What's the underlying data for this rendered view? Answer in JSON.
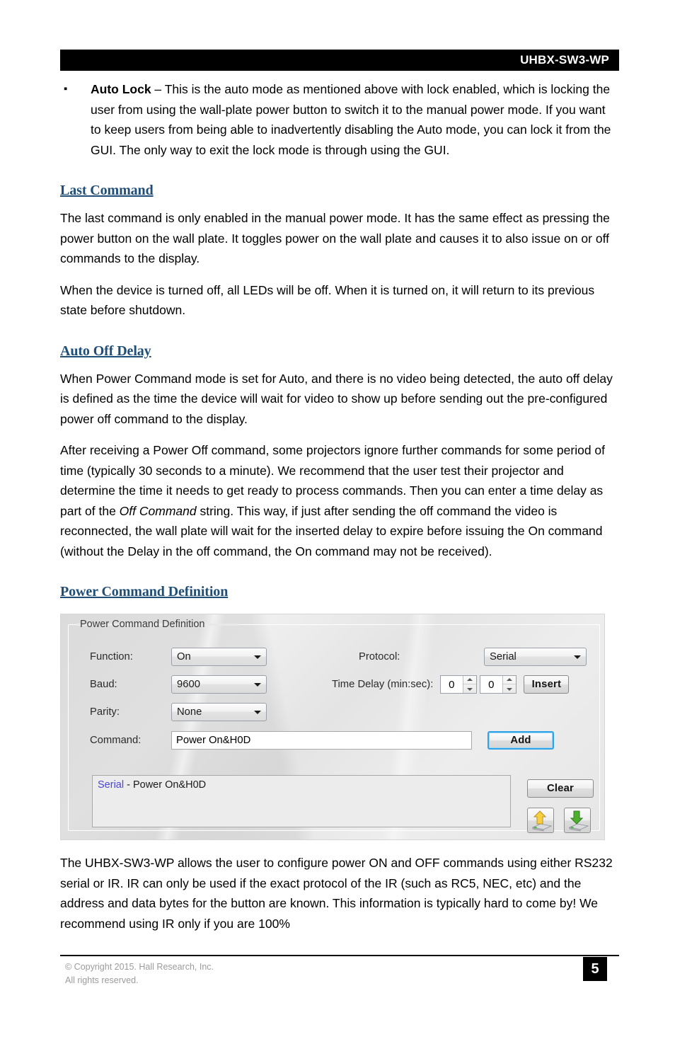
{
  "header": {
    "title": "UHBX-SW3-WP"
  },
  "colors": {
    "heading": "#1F4E79",
    "header_bar": "#000000",
    "focus_ring": "#2FA3E8",
    "list_protocol": "#4A46D6",
    "footer_text": "#9B9B9B"
  },
  "bullets": [
    {
      "glyph": "▪",
      "lead": "Auto Lock",
      "text": " – This is the auto mode as mentioned above with lock enabled, which is locking the user from using the wall-plate power button to switch it to the manual power mode. If you want to keep users from being able to inadvertently disabling the Auto mode, you can lock it from the GUI. The only way to exit the lock mode is through using the GUI."
    }
  ],
  "sections": [
    {
      "heading": "Last Command",
      "paragraphs": [
        "The last command is only enabled in the manual power mode. It has the same effect as pressing the power button on the wall plate. It toggles power on the wall plate and causes it to also issue on or off commands to the display.",
        "When the device is turned off, all LEDs will be off. When it is turned on, it will return to its previous state before shutdown."
      ]
    },
    {
      "heading": "Auto Off Delay",
      "paragraphs": [
        "When Power Command mode is set for Auto, and there is no video being detected, the auto off delay is defined as the time the device will wait for video to show up before sending out the pre-configured power off command to the display."
      ],
      "paragraph2_parts": {
        "a": "After receiving a Power Off command, some projectors ignore further commands for some period of time (typically 30 seconds to a minute). We recommend that the user test their projector and determine the time it needs to get ready to process commands. Then you can enter a time delay as part of the ",
        "italic": "Off Command",
        "b": " string. This way, if just after sending the off command the video is reconnected, the wall plate will wait for the inserted delay to expire before issuing the On command (without the Delay in the off command, the On command may not be received)."
      }
    },
    {
      "heading": "Power Command Definition"
    }
  ],
  "gui": {
    "groupbox_title": "Power Command Definition",
    "fields": {
      "function_label": "Function:",
      "function_value": "On",
      "baud_label": "Baud:",
      "baud_value": "9600",
      "parity_label": "Parity:",
      "parity_value": "None",
      "command_label": "Command:",
      "command_value": "Power On&H0D",
      "protocol_label": "Protocol:",
      "protocol_value": "Serial",
      "time_delay_label": "Time Delay (min:sec):",
      "time_delay_min": "0",
      "time_delay_sec": "0"
    },
    "buttons": {
      "insert": "Insert",
      "add": "Add",
      "clear": "Clear"
    },
    "icon_buttons": [
      {
        "name": "upload-to-device-icon"
      },
      {
        "name": "download-from-device-icon"
      }
    ],
    "list_items": [
      {
        "protocol": "Serial",
        "rest": " - Power On&H0D"
      }
    ]
  },
  "closing_paragraph": "The UHBX-SW3-WP allows the user to configure power ON and OFF commands using either RS232 serial or IR. IR can only be used if the exact protocol of the IR (such as RC5, NEC, etc) and the address and data bytes for the button are known. This information is typically hard to come by!  We recommend using IR only if you are 100%",
  "footer": {
    "copyright_line1": "© Copyright 2015. Hall Research, Inc.",
    "copyright_line2": "All rights reserved.",
    "page_number": "5"
  }
}
